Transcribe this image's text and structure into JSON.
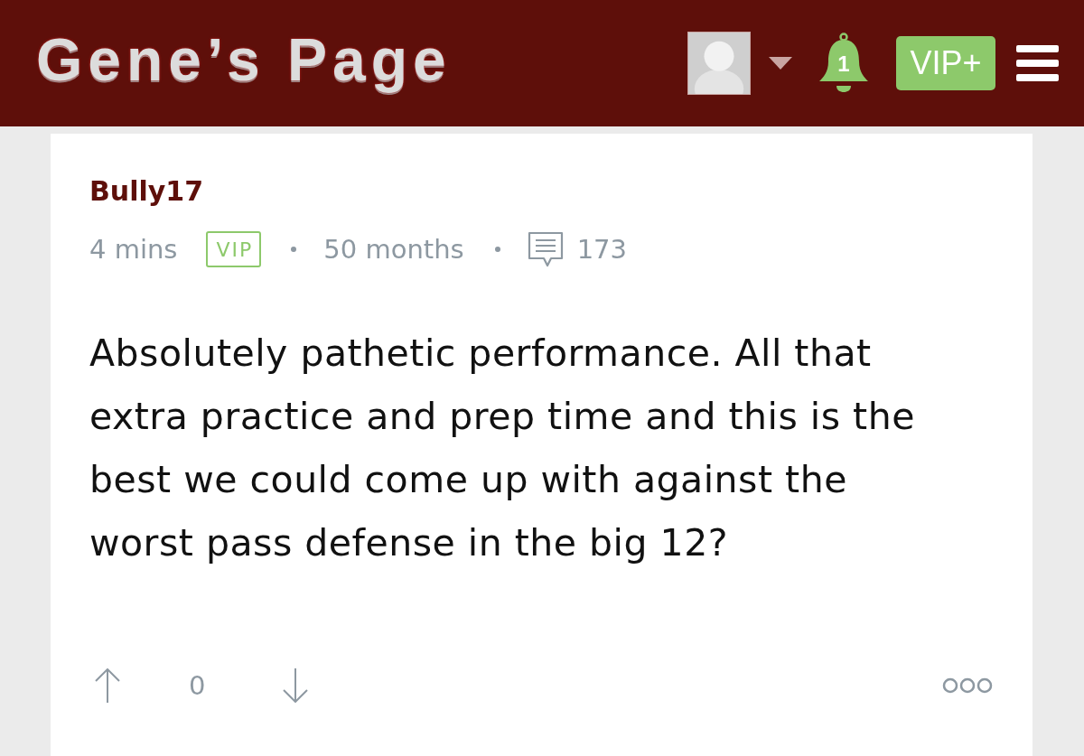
{
  "header": {
    "logo": "Gene’s Page",
    "notification_count": "1",
    "vip_button": "VIP+"
  },
  "post": {
    "author": "Bully17",
    "time": "4 mins",
    "badge": "VIP",
    "membership": "50 months",
    "comment_count": "173",
    "body": "Absolutely pathetic performance. All that extra practice and prep time and this is the best we could come up with against the worst pass defense in the big 12?",
    "score": "0"
  }
}
